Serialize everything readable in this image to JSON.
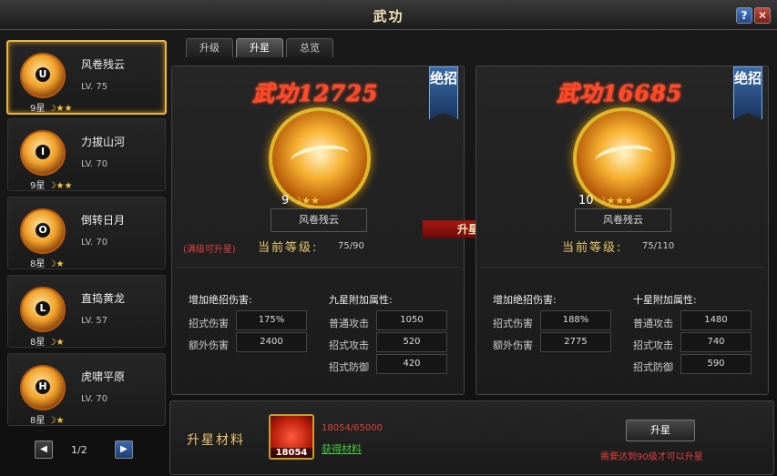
{
  "window": {
    "title": "武功",
    "help": "?",
    "close": "✕"
  },
  "tabs": [
    "升级",
    "升星",
    "总览"
  ],
  "skills": [
    {
      "key": "U",
      "name": "风卷残云",
      "lv": "LV. 75",
      "stars": "9星"
    },
    {
      "key": "I",
      "name": "力拔山河",
      "lv": "LV. 70",
      "stars": "9星"
    },
    {
      "key": "O",
      "name": "倒转日月",
      "lv": "LV. 70",
      "stars": "8星"
    },
    {
      "key": "L",
      "name": "直捣黄龙",
      "lv": "LV. 57",
      "stars": "8星"
    },
    {
      "key": "H",
      "name": "虎啸平原",
      "lv": "LV. 70",
      "stars": "8星"
    }
  ],
  "pager": {
    "text": "1/2",
    "prev": "◀",
    "next": "▶"
  },
  "left_panel": {
    "power": "武功12725",
    "badge": "绝招",
    "level_num": "9",
    "skill_name": "风卷残云",
    "hint": "(满级可升星)",
    "current_label": "当前等级:",
    "current_value": "75/90",
    "left_header": "增加绝招伤害:",
    "right_header": "九星附加属性:",
    "stats_left": [
      {
        "label": "招式伤害",
        "value": "175%"
      },
      {
        "label": "额外伤害",
        "value": "2400"
      }
    ],
    "stats_right": [
      {
        "label": "普通攻击",
        "value": "1050"
      },
      {
        "label": "招式攻击",
        "value": "520"
      },
      {
        "label": "招式防御",
        "value": "420"
      }
    ]
  },
  "right_panel": {
    "power": "武功16685",
    "badge": "绝招",
    "level_num": "10",
    "skill_name": "风卷残云",
    "current_label": "当前等级:",
    "current_value": "75/110",
    "left_header": "增加绝招伤害:",
    "right_header": "十星附加属性:",
    "stats_left": [
      {
        "label": "招式伤害",
        "value": "188%"
      },
      {
        "label": "额外伤害",
        "value": "2775"
      }
    ],
    "stats_right": [
      {
        "label": "普通攻击",
        "value": "1480"
      },
      {
        "label": "招式攻击",
        "value": "740"
      },
      {
        "label": "招式防御",
        "value": "590"
      }
    ]
  },
  "arrow_label": "升星",
  "material": {
    "label": "升星材料",
    "count_badge": "18054",
    "count": "18054/65000",
    "get_link": "获得材料",
    "upgrade_button": "升星",
    "requirement": "需要达到90级才可以升星"
  }
}
